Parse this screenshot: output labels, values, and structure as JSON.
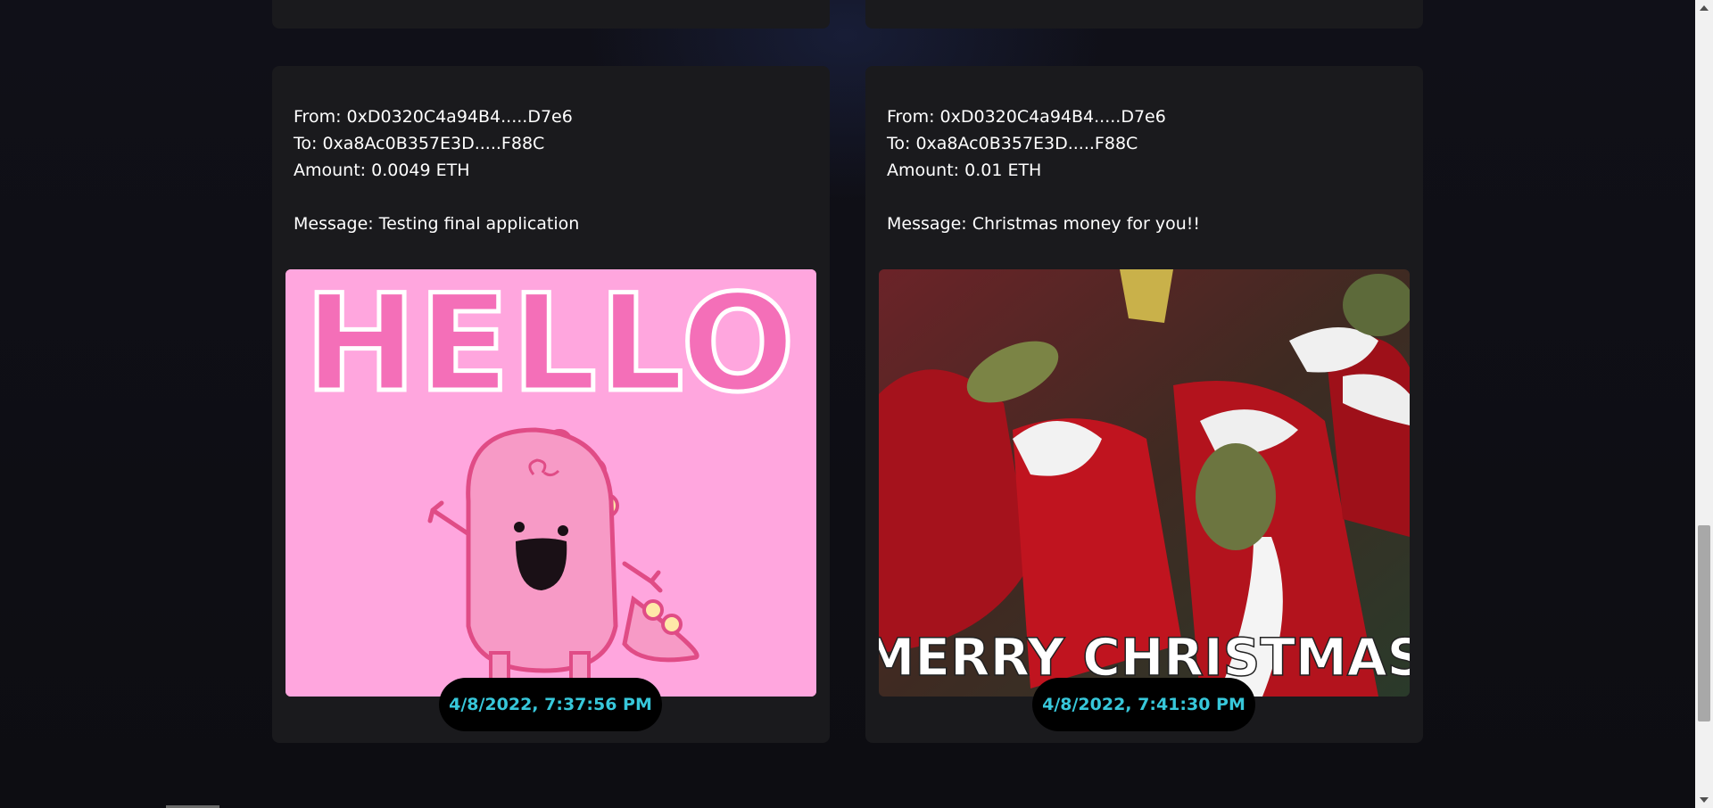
{
  "transactions": [
    {
      "from": "From: 0xD0320C4a94B4.....D7e6",
      "to": "To: 0xa8Ac0B357E3D.....F88C",
      "amount": "Amount: 0.0049 ETH",
      "message": "Message: Testing final application",
      "timestamp": "4/8/2022, 7:37:56 PM",
      "gif": {
        "text": "HELLO",
        "bg": "#ffa6de",
        "letter_color": "#f46fb8"
      }
    },
    {
      "from": "From: 0xD0320C4a94B4.....D7e6",
      "to": "To: 0xa8Ac0B357E3D.....F88C",
      "amount": "Amount: 0.01 ETH",
      "message": "Message: Christmas money for you!!",
      "timestamp": "4/8/2022, 7:41:30 PM",
      "gif": {
        "text": "MERRY CHRISTMAS",
        "bg": "#5a2a2a",
        "letter_color": "#ffffff"
      }
    }
  ],
  "colors": {
    "page_bg": "#0f0e13",
    "card_bg": "#1a1a1d",
    "timestamp_text": "#37c7da",
    "pill_bg": "#000000"
  }
}
